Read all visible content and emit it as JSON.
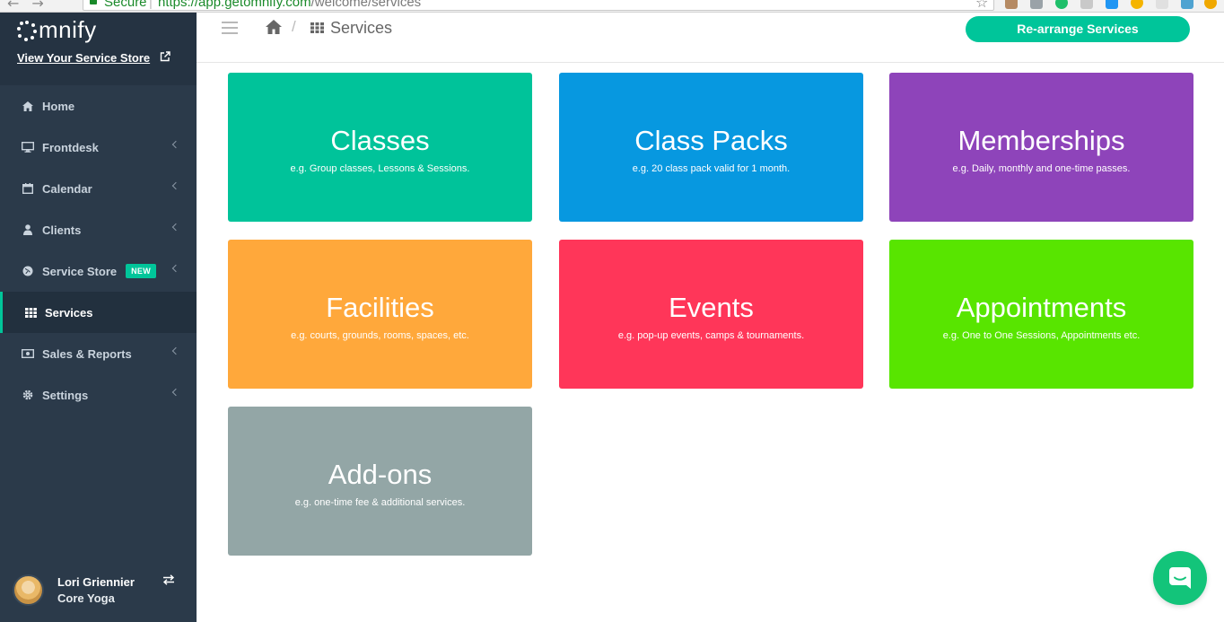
{
  "browser": {
    "secure_label": "Secure",
    "url_host": "https://app.getomnify.com",
    "url_path": "/welcome/services"
  },
  "sidebar": {
    "logo_text": "mnify",
    "store_link": "View Your Service Store",
    "items": [
      {
        "label": "Home",
        "icon": "home-icon"
      },
      {
        "label": "Frontdesk",
        "icon": "monitor-icon"
      },
      {
        "label": "Calendar",
        "icon": "calendar-icon"
      },
      {
        "label": "Clients",
        "icon": "user-icon"
      },
      {
        "label": "Service Store",
        "icon": "globe-icon",
        "badge": "NEW"
      },
      {
        "label": "Services",
        "icon": "grid-icon",
        "active": true
      },
      {
        "label": "Sales & Reports",
        "icon": "money-icon"
      },
      {
        "label": "Settings",
        "icon": "gear-icon"
      }
    ],
    "user": {
      "name": "Lori Griennier",
      "org": "Core Yoga"
    }
  },
  "header": {
    "breadcrumb_current": "Services",
    "rearrange_label": "Re-arrange Services"
  },
  "cards": [
    {
      "title": "Classes",
      "subtitle": "e.g. Group classes, Lessons & Sessions.",
      "color": "#00c39a"
    },
    {
      "title": "Class Packs",
      "subtitle": "e.g. 20 class pack valid for 1 month.",
      "color": "#0798e0"
    },
    {
      "title": "Memberships",
      "subtitle": "e.g. Daily, monthly and one-time passes.",
      "color": "#8e44ba"
    },
    {
      "title": "Facilities",
      "subtitle": "e.g. courts, grounds, rooms, spaces, etc.",
      "color": "#ffa83b"
    },
    {
      "title": "Events",
      "subtitle": "e.g. pop-up events, camps & tournaments.",
      "color": "#ff3659"
    },
    {
      "title": "Appointments",
      "subtitle": "e.g. One to One Sessions, Appointments etc.",
      "color": "#58e500"
    },
    {
      "title": "Add-ons",
      "subtitle": "e.g. one-time fee & additional services.",
      "color": "#93a6a6"
    }
  ],
  "colors": {
    "accent": "#00c59a",
    "sidebar_bg": "#2b3a4a",
    "chat": "#13c47a"
  }
}
